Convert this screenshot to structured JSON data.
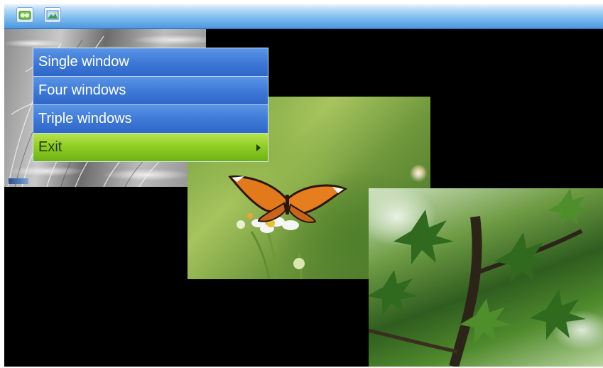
{
  "toolbar": {
    "buttons": [
      {
        "name": "media-icon",
        "color": "#7dc14a"
      },
      {
        "name": "picture-icon",
        "color": "#3c82d2"
      }
    ]
  },
  "menu": {
    "items": [
      {
        "label": "Single window",
        "selected": false
      },
      {
        "label": "Four windows",
        "selected": false
      },
      {
        "label": "Triple windows",
        "selected": false
      },
      {
        "label": "Exit",
        "selected": true,
        "submenu_arrow": "chevron-right-icon"
      }
    ]
  },
  "colors": {
    "menu_blue": "#3f7ad8",
    "menu_selected_green": "#8ccc23",
    "background": "#000000",
    "toolbar_blue": "#4a97e0"
  }
}
